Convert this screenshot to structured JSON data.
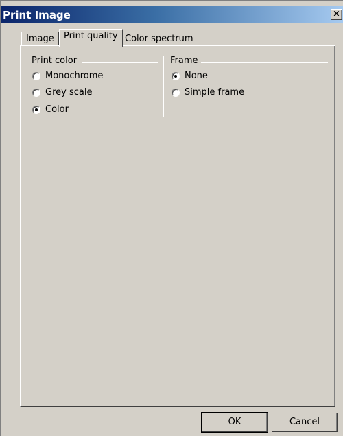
{
  "window": {
    "title": "Print Image",
    "close_glyph": "×",
    "close_icon": "close-icon"
  },
  "tabs": [
    {
      "label": "Image",
      "selected": false
    },
    {
      "label": "Print quality",
      "selected": true
    },
    {
      "label": "Color spectrum",
      "selected": false
    }
  ],
  "print_color": {
    "label": "Print color",
    "options": [
      {
        "label": "Monochrome",
        "checked": false
      },
      {
        "label": "Grey scale",
        "checked": false
      },
      {
        "label": "Color",
        "checked": true
      }
    ]
  },
  "frame": {
    "label": "Frame",
    "options": [
      {
        "label": "None",
        "checked": true
      },
      {
        "label": "Simple frame",
        "checked": false
      }
    ]
  },
  "buttons": {
    "ok_label": "OK",
    "cancel_label": "Cancel"
  }
}
